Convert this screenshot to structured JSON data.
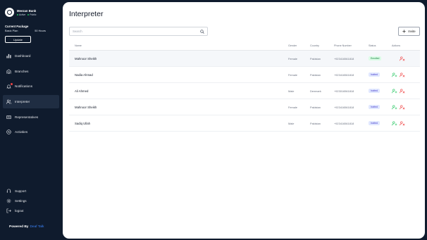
{
  "org": {
    "name": "Meezan Bank",
    "tag1": "Active",
    "tag2": "Public"
  },
  "package": {
    "title": "Current Package",
    "plan": "Basic Plan",
    "hours": "50 Hours",
    "update_label": "Update"
  },
  "nav": {
    "dashboard": "Dashboard",
    "branches": "Branches",
    "notifications": "Notifications",
    "interpreter": "Interpreter",
    "representatives": "Representatives",
    "activities": "Activities",
    "support": "Support",
    "settings": "Settings",
    "logout": "logout"
  },
  "powered": {
    "label": "Powered By",
    "brand": "Deaf Talk"
  },
  "page": {
    "title": "Interpreter"
  },
  "search": {
    "placeholder": "Search"
  },
  "invite_label": "Invite",
  "table": {
    "headers": {
      "name": "Name",
      "gender": "Gender",
      "country": "Country",
      "phone": "Phone Number",
      "status": "Status",
      "actions": "Actions"
    },
    "rows": [
      {
        "name": "Mahnoor Sheikh",
        "gender": "Female",
        "country": "Pakistan",
        "phone": "+923416561818",
        "status": "Enrolled"
      },
      {
        "name": "Nadia Ahmad",
        "gender": "Female",
        "country": "Pakistan",
        "phone": "+923416561818",
        "status": "Invited"
      },
      {
        "name": "Ali Ahmed",
        "gender": "Male",
        "country": "Denmark",
        "phone": "+923016561818",
        "status": "Invited"
      },
      {
        "name": "Mahnoor Sheikh",
        "gender": "Female",
        "country": "Pakistan",
        "phone": "+923416561818",
        "status": "Invited"
      },
      {
        "name": "Sadiq Ullah",
        "gender": "Male",
        "country": "Pakistan",
        "phone": "+923416561818",
        "status": "Invited"
      }
    ]
  },
  "colors": {
    "sidebar": "#0f1b2d",
    "enrolled": "#15803d",
    "invited": "#4338ca",
    "add_user": "#22c55e",
    "remove_user": "#ef4444"
  }
}
